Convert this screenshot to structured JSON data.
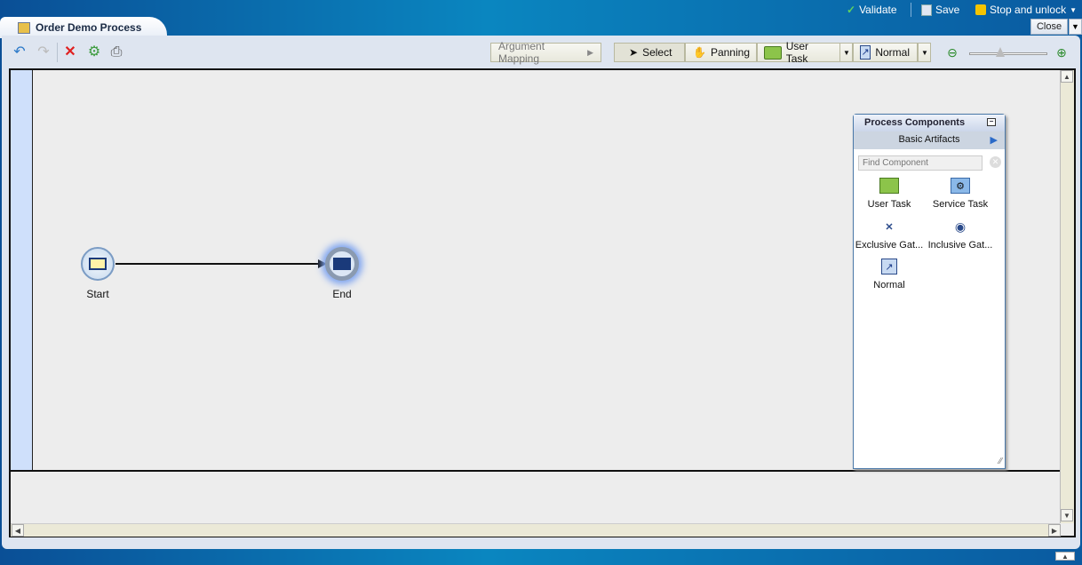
{
  "header": {
    "actions": [
      {
        "label": "Validate",
        "icon": "checkmark-icon"
      },
      {
        "label": "Save",
        "icon": "floppy-disk-icon"
      },
      {
        "label": "Stop and unlock",
        "icon": "padlock-icon"
      }
    ],
    "tab_title": "Order Demo Process",
    "close_label": "Close"
  },
  "toolbar": {
    "icons": [
      "undo-icon",
      "redo-icon",
      "delete-icon",
      "generate-icon",
      "print-icon"
    ],
    "argument_mapping": "Argument Mapping",
    "select": "Select",
    "panning": "Panning",
    "user_task": "User Task",
    "normal": "Normal",
    "zoom_level": 0.45
  },
  "diagram": {
    "nodes": [
      {
        "label": "Start",
        "type": "message start event"
      },
      {
        "label": "End",
        "type": "message end event"
      }
    ]
  },
  "palette": {
    "title": "Process Components",
    "section": "Basic Artifacts",
    "search_placeholder": "Find Component",
    "items": [
      {
        "label": "User Task",
        "icon": "user-task-icon"
      },
      {
        "label": "Service Task",
        "icon": "service-task-icon"
      },
      {
        "label": "Exclusive Gat...",
        "icon": "exclusive-gateway-icon"
      },
      {
        "label": "Inclusive Gat...",
        "icon": "inclusive-gateway-icon"
      },
      {
        "label": "Normal",
        "icon": "normal-flow-icon"
      }
    ]
  },
  "colors": {
    "brand_blue": "#0a6fb0",
    "lane": "#cfe0fb",
    "canvas": "#ededed"
  }
}
